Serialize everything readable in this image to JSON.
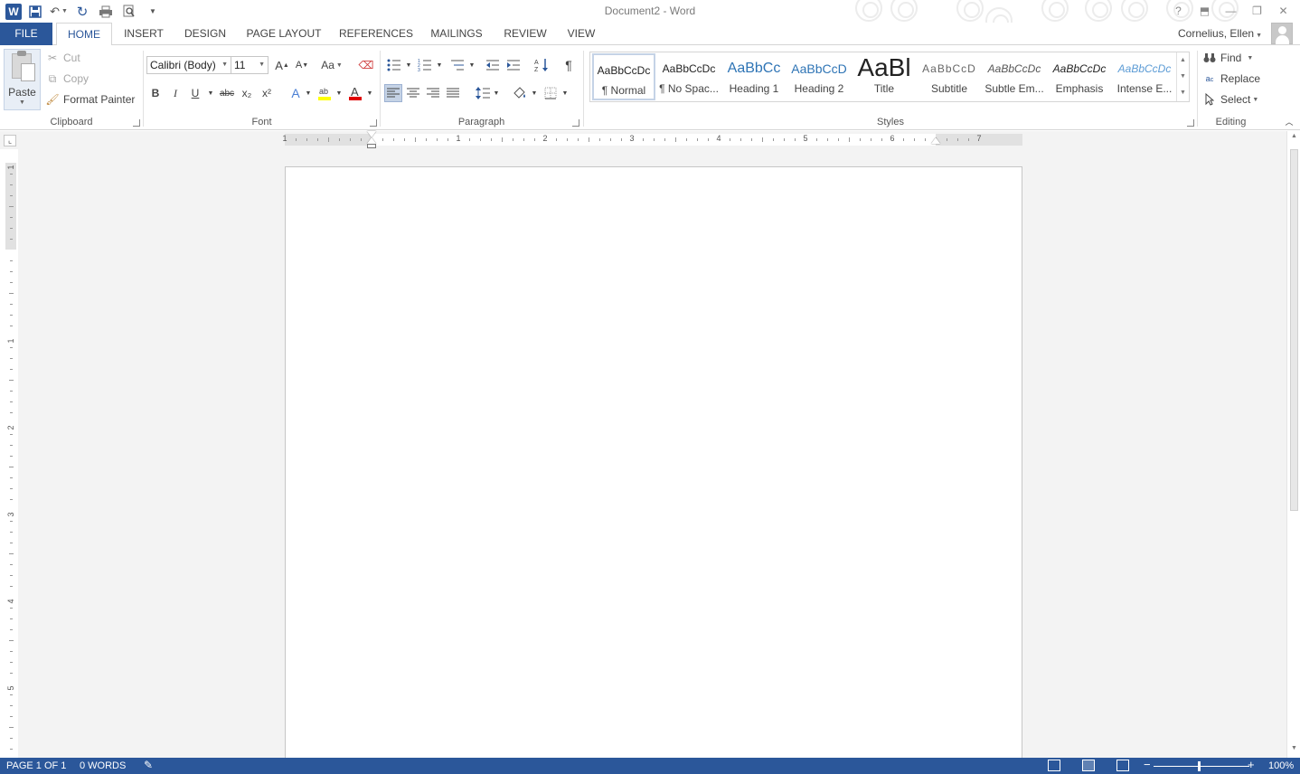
{
  "window": {
    "title": "Document2 - Word",
    "help": "?",
    "controls": [
      "ribbon-options",
      "minimize",
      "restore",
      "close"
    ]
  },
  "tabs": {
    "file": "FILE",
    "home": "HOME",
    "insert": "INSERT",
    "design": "DESIGN",
    "page_layout": "PAGE LAYOUT",
    "references": "REFERENCES",
    "mailings": "MAILINGS",
    "review": "REVIEW",
    "view": "VIEW"
  },
  "user": {
    "name": "Cornelius, Ellen"
  },
  "clipboard": {
    "label": "Clipboard",
    "paste": "Paste",
    "cut": "Cut",
    "copy": "Copy",
    "format_painter": "Format Painter"
  },
  "font": {
    "label": "Font",
    "family": "Calibri (Body)",
    "size": "11",
    "change_case": "Aa",
    "bold": "B",
    "italic": "I",
    "underline": "U",
    "strikethrough": "abc",
    "subscript": "x₂",
    "superscript": "x²",
    "font_color_hex": "#e00000",
    "highlight_hex": "#ffff00"
  },
  "paragraph": {
    "label": "Paragraph"
  },
  "styles": {
    "label": "Styles",
    "items": [
      {
        "sample": "AaBbCcDc",
        "name": "¶ Normal"
      },
      {
        "sample": "AaBbCcDc",
        "name": "¶ No Spac..."
      },
      {
        "sample": "AaBbCc",
        "name": "Heading 1"
      },
      {
        "sample": "AaBbCcD",
        "name": "Heading 2"
      },
      {
        "sample": "AaBl",
        "name": "Title"
      },
      {
        "sample": "AaBbCcD",
        "name": "Subtitle"
      },
      {
        "sample": "AaBbCcDc",
        "name": "Subtle Em..."
      },
      {
        "sample": "AaBbCcDc",
        "name": "Emphasis"
      },
      {
        "sample": "AaBbCcDc",
        "name": "Intense E..."
      }
    ]
  },
  "editing": {
    "label": "Editing",
    "find": "Find",
    "replace": "Replace",
    "select": "Select"
  },
  "ruler": {
    "h_numbers": [
      "1",
      "1",
      "2",
      "3",
      "4",
      "5",
      "6",
      "7"
    ],
    "v_numbers": [
      "1",
      "1",
      "2",
      "3",
      "4",
      "5"
    ]
  },
  "status": {
    "page": "PAGE 1 OF 1",
    "words": "0 WORDS",
    "zoom": "100%",
    "zoom_minus": "−",
    "zoom_plus": "+"
  },
  "colors": {
    "accent": "#2b579a",
    "status_bg": "#2b579a",
    "doc_bg": "#f3f3f3"
  }
}
